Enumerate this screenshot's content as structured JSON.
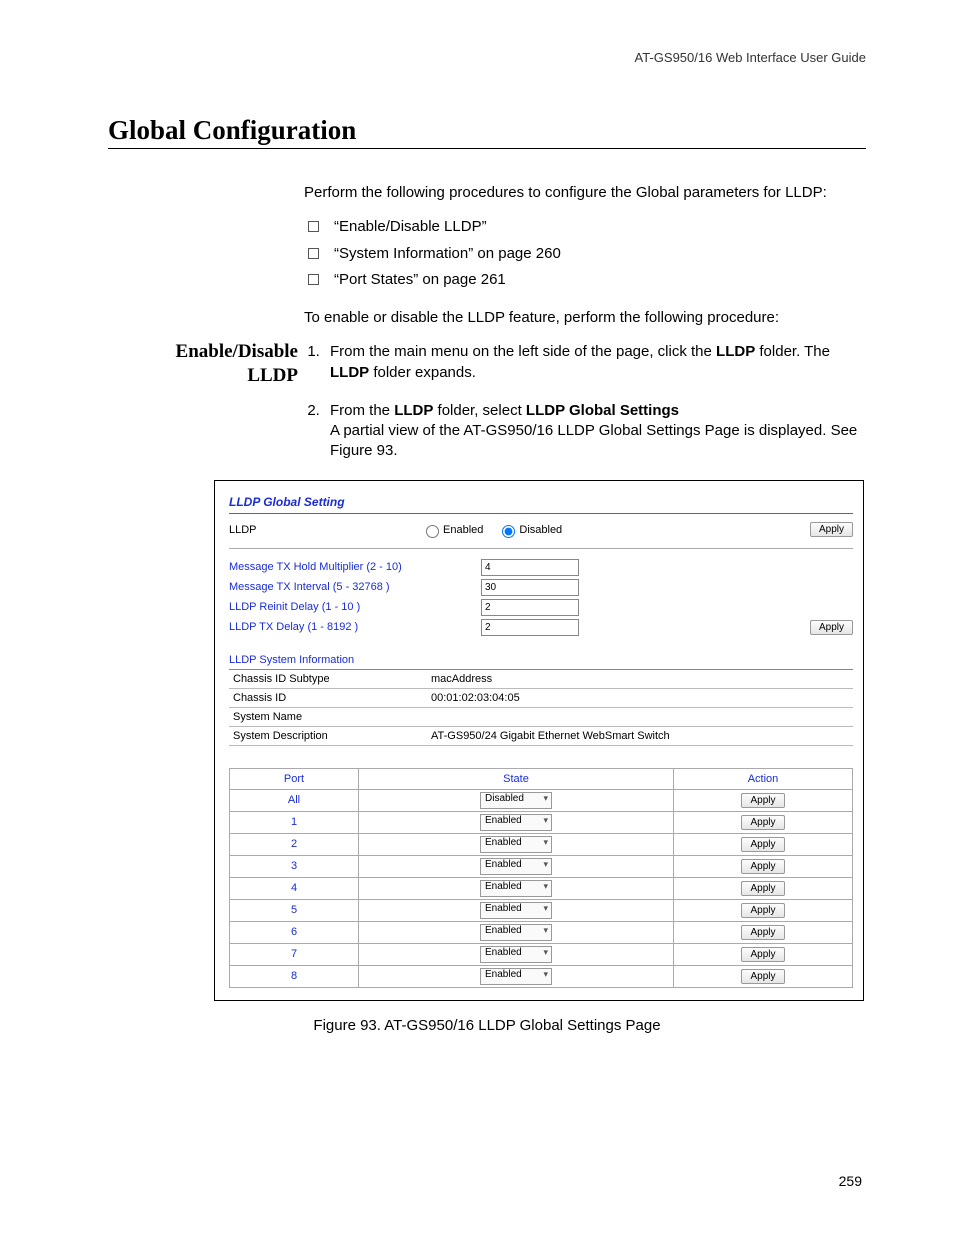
{
  "header": {
    "doc_title": "AT-GS950/16  Web Interface User Guide"
  },
  "title": "Global Configuration",
  "intro": "Perform the following procedures to configure the Global parameters for LLDP:",
  "checklist": [
    "“Enable/Disable LLDP”",
    "“System Information” on page 260",
    "“Port States” on page 261"
  ],
  "side_heading": "Enable/Disable LLDP",
  "side_intro": "To enable or disable the LLDP feature, perform the following procedure:",
  "steps": {
    "s1_a": "From the main menu on the left side of the page, click the ",
    "s1_b": "LLDP",
    "s1_c": " folder. The ",
    "s1_d": "LLDP",
    "s1_e": " folder expands.",
    "s2_a": "From the ",
    "s2_b": "LLDP",
    "s2_c": " folder, select ",
    "s2_d": "LLDP Global Settings",
    "s2_e": "A partial view of the AT-GS950/16 LLDP Global Settings Page is displayed. See Figure 93."
  },
  "figure": {
    "panel_title": "LLDP Global Setting",
    "lldp_label": "LLDP",
    "enabled_label": "Enabled",
    "disabled_label": "Disabled",
    "apply_label": "Apply",
    "params": [
      {
        "label": "Message TX Hold Multiplier  (2 - 10)",
        "value": "4"
      },
      {
        "label": "Message TX Interval   (5 - 32768 )",
        "value": "30"
      },
      {
        "label": "LLDP Reinit Delay   (1 - 10 )",
        "value": "2"
      },
      {
        "label": "LLDP TX Delay   (1 - 8192 )",
        "value": "2"
      }
    ],
    "sysinfo_title": "LLDP System Information",
    "sysinfo": [
      {
        "k": "Chassis ID Subtype",
        "v": "macAddress"
      },
      {
        "k": "Chassis ID",
        "v": "00:01:02:03:04:05"
      },
      {
        "k": "System Name",
        "v": ""
      },
      {
        "k": "System Description",
        "v": "AT-GS950/24 Gigabit Ethernet WebSmart Switch"
      }
    ],
    "ports_header": {
      "port": "Port",
      "state": "State",
      "action": "Action"
    },
    "ports": [
      {
        "port": "All",
        "state": "Disabled"
      },
      {
        "port": "1",
        "state": "Enabled"
      },
      {
        "port": "2",
        "state": "Enabled"
      },
      {
        "port": "3",
        "state": "Enabled"
      },
      {
        "port": "4",
        "state": "Enabled"
      },
      {
        "port": "5",
        "state": "Enabled"
      },
      {
        "port": "6",
        "state": "Enabled"
      },
      {
        "port": "7",
        "state": "Enabled"
      },
      {
        "port": "8",
        "state": "Enabled"
      }
    ]
  },
  "figure_caption": "Figure 93. AT-GS950/16 LLDP Global Settings Page",
  "page_number": "259"
}
